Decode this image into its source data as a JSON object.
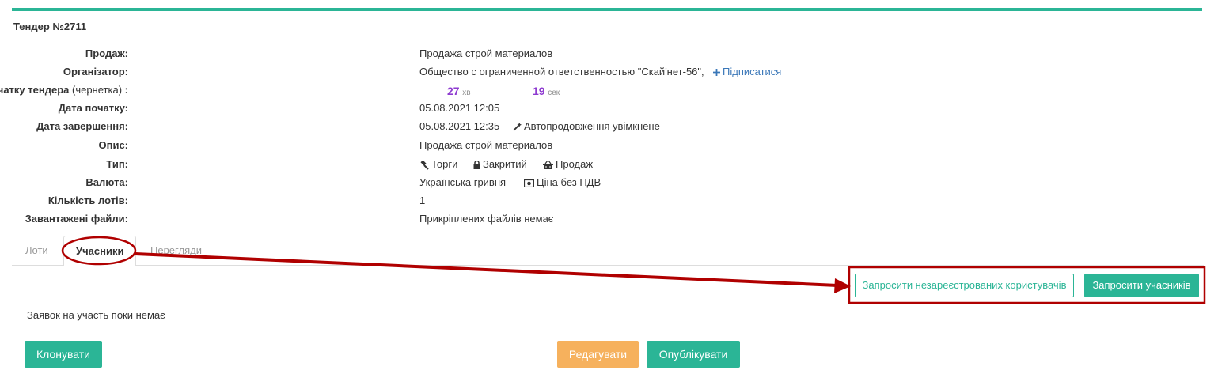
{
  "title": "Тендер №2711",
  "info": {
    "sale_label": "Продаж:",
    "sale_value": "Продажа строй материалов",
    "organizer_label": "Організатор:",
    "organizer_value": "Общество с ограниченной ответственностью \"Скай'нет-56\",",
    "subscribe_label": "Підписатися",
    "countdown_label": "До початку тендера",
    "countdown_sub": "(чернетка)",
    "countdown_colon": ":",
    "minutes": "27",
    "minutes_unit": "хв",
    "seconds": "19",
    "seconds_unit": "сек",
    "start_label": "Дата початку:",
    "start_value": "05.08.2021 12:05",
    "end_label": "Дата завершення:",
    "end_value": "05.08.2021 12:35",
    "auto_extend": "Автопродовження увімкнене",
    "desc_label": "Опис:",
    "desc_value": "Продажа строй материалов",
    "type_label": "Тип:",
    "type_auction": "Торги",
    "type_closed": "Закритий",
    "type_sale": "Продаж",
    "currency_label": "Валюта:",
    "currency_value": "Українська гривня",
    "vat_value": "Ціна без ПДВ",
    "lots_count_label": "Кількість лотів:",
    "lots_count_value": "1",
    "files_label": "Завантажені файли:",
    "files_value": "Прикріплених файлів немає"
  },
  "tabs": [
    {
      "label": "Лоти",
      "active": false
    },
    {
      "label": "Учасники",
      "active": true
    },
    {
      "label": "Перегляди",
      "active": false
    }
  ],
  "participants": {
    "invite_unregistered": "Запросити незареєстрованих користувачів",
    "invite_participants": "Запросити учасників",
    "empty_note": "Заявок на участь поки немає"
  },
  "actions": {
    "clone": "Клонувати",
    "edit": "Редагувати",
    "publish": "Опублікувати"
  },
  "colors": {
    "accent": "#2bb596",
    "warning": "#f6b15d",
    "timer": "#8e3bd0",
    "link": "#3a77b8",
    "annotation": "#b00000"
  }
}
